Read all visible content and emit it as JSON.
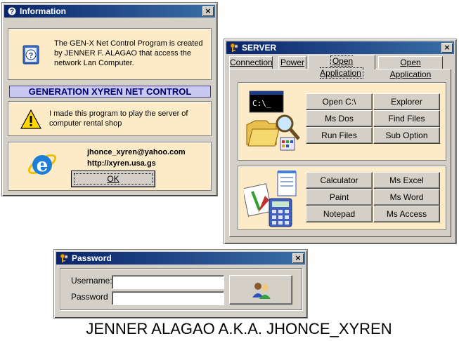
{
  "info_window": {
    "title": "Information",
    "description": "The GEN-X Net Control Program is created by JENNER F. ALAGAO that access the network Lan Computer.",
    "banner": "GENERATION XYREN NET CONTROL",
    "warning": "I made this program to play the server of computer rental shop",
    "email": "jhonce_xyren@yahoo.com",
    "url": "http://xyren.usa.gs",
    "ok_label": "OK",
    "close_label": "×"
  },
  "server_window": {
    "title": "SERVER",
    "close_label": "×",
    "tabs": [
      "Connection",
      "Power",
      "Open Application",
      "Open Application"
    ],
    "active_tab": 2,
    "group1": [
      "Open C:\\",
      "Explorer",
      "Ms Dos",
      "Find Files",
      "Run Files",
      "Sub Option"
    ],
    "group2": [
      "Calculator",
      "Ms Excel",
      "Paint",
      "Ms Word",
      "Notepad",
      "Ms Access"
    ],
    "cmd_icon_text": "C:\\_"
  },
  "password_window": {
    "title": "Password",
    "close_label": "×",
    "username_label": "Username:",
    "password_label": "Password",
    "username_value": "",
    "password_value": ""
  },
  "footer": {
    "caption": "JENNER ALAGAO A.K.A. JHONCE_XYREN"
  }
}
